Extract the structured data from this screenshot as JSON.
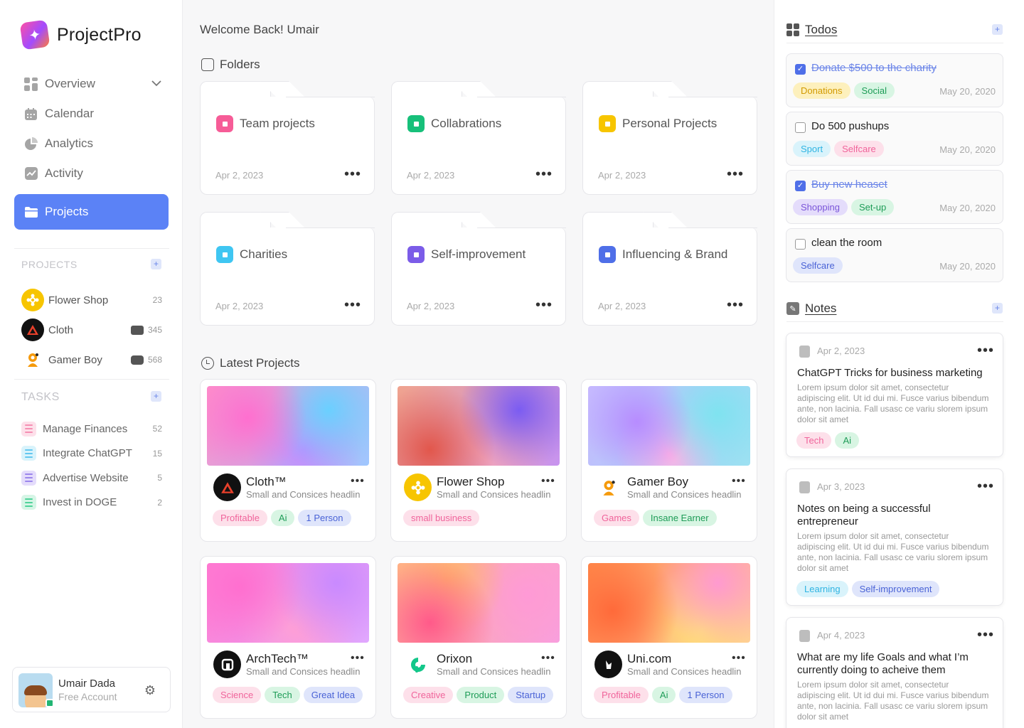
{
  "app": {
    "name": "ProjectPro"
  },
  "nav": [
    {
      "label": "Overview",
      "icon": "grid-icon"
    },
    {
      "label": "Calendar",
      "icon": "calendar-icon"
    },
    {
      "label": "Analytics",
      "icon": "pie-chart-icon"
    },
    {
      "label": "Activity",
      "icon": "activity-icon"
    },
    {
      "label": "Projects",
      "icon": "folder-icon",
      "active": true
    }
  ],
  "sidebar_projects": {
    "title": "PROJECTS",
    "items": [
      {
        "name": "Flower Shop",
        "count": "23"
      },
      {
        "name": "Cloth",
        "count": "345"
      },
      {
        "name": "Gamer Boy",
        "count": "568"
      }
    ]
  },
  "sidebar_tasks": {
    "title": "TASKS",
    "items": [
      {
        "name": "Manage Finances",
        "count": "52",
        "color": "#f58fb3"
      },
      {
        "name": "Integrate ChatGPT",
        "count": "15",
        "color": "#63c7f0"
      },
      {
        "name": "Advertise Website",
        "count": "5",
        "color": "#9b86ec"
      },
      {
        "name": "Invest in DOGE",
        "count": "2",
        "color": "#4fd39a"
      }
    ]
  },
  "user": {
    "name": "Umair Dada",
    "plan": "Free Account"
  },
  "main": {
    "welcome": "Welcome Back! Umair",
    "folders_title": "Folders",
    "folders": [
      {
        "name": "Team projects",
        "date": "Apr 2, 2023",
        "color": "#f65c97"
      },
      {
        "name": "Collabrations",
        "date": "Apr 2, 2023",
        "color": "#17c07a"
      },
      {
        "name": "Personal Projects",
        "date": "Apr 2, 2023",
        "color": "#f7c500"
      },
      {
        "name": "Charities",
        "date": "Apr 2, 2023",
        "color": "#3fc6f2"
      },
      {
        "name": "Self-improvement",
        "date": "Apr 2, 2023",
        "color": "#7b5ce8"
      },
      {
        "name": "Influencing & Brand",
        "date": "Apr 2, 2023",
        "color": "#4f6fe8"
      }
    ],
    "latest_title": "Latest Projects",
    "projects": [
      {
        "title": "Cloth™",
        "subtitle": "Small and Consices headlin",
        "tags": [
          "Profitable",
          "Ai",
          "1 Person"
        ]
      },
      {
        "title": "Flower Shop",
        "subtitle": "Small and Consices headlin",
        "tags": [
          "small business"
        ]
      },
      {
        "title": "Gamer Boy",
        "subtitle": "Small and Consices headlin",
        "tags": [
          "Games",
          "Insane Earner"
        ]
      },
      {
        "title": "ArchTech™",
        "subtitle": "Small and Consices headlin",
        "tags": [
          "Science",
          "Tech",
          "Great Idea"
        ]
      },
      {
        "title": "Orixon",
        "subtitle": "Small and Consices headlin",
        "tags": [
          "Creative",
          "Product",
          "Startup"
        ]
      },
      {
        "title": "Uni.com",
        "subtitle": "Small and Consices headlin",
        "tags": [
          "Profitable",
          "Ai",
          "1 Person"
        ]
      }
    ]
  },
  "todos": {
    "title": "Todos",
    "items": [
      {
        "text": "Donate $500 to the charity",
        "done": true,
        "tags": [
          "Donations",
          "Social"
        ],
        "date": "May 20, 2020"
      },
      {
        "text": "Do 500 pushups",
        "done": false,
        "tags": [
          "Sport",
          "Selfcare"
        ],
        "date": "May 20, 2020"
      },
      {
        "text": "Buy new heaset",
        "done": true,
        "tags": [
          "Shopping",
          "Set-up"
        ],
        "date": "May 20, 2020"
      },
      {
        "text": "clean the room",
        "done": false,
        "tags": [
          "Selfcare"
        ],
        "date": "May 20, 2020"
      }
    ]
  },
  "notes": {
    "title": "Notes",
    "items": [
      {
        "date": "Apr 2, 2023",
        "title": "ChatGPT Tricks for business marketing",
        "body": "Lorem ipsum dolor sit amet, consectetur adipiscing elit. Ut id dui mi. Fusce varius bibendum ante, non lacinia. Fall usasc ce variu slorem ipsum dolor sit amet",
        "tags": [
          "Tech",
          "Ai"
        ]
      },
      {
        "date": "Apr 3, 2023",
        "title": "Notes on being a successful entrepreneur",
        "body": "Lorem ipsum dolor sit amet, consectetur adipiscing elit. Ut id dui mi. Fusce varius bibendum ante, non lacinia. Fall usasc ce variu slorem ipsum dolor sit amet",
        "tags": [
          "Learning",
          "Self-improvement"
        ]
      },
      {
        "date": "Apr 4, 2023",
        "title": "What are my life Goals and what I’m currently doing to acheive them",
        "body": "Lorem ipsum dolor sit amet, consectetur adipiscing elit. Ut id dui mi. Fusce varius bibendum ante, non lacinia. Fall usasc ce variu slorem ipsum dolor sit amet",
        "tags": []
      }
    ]
  }
}
